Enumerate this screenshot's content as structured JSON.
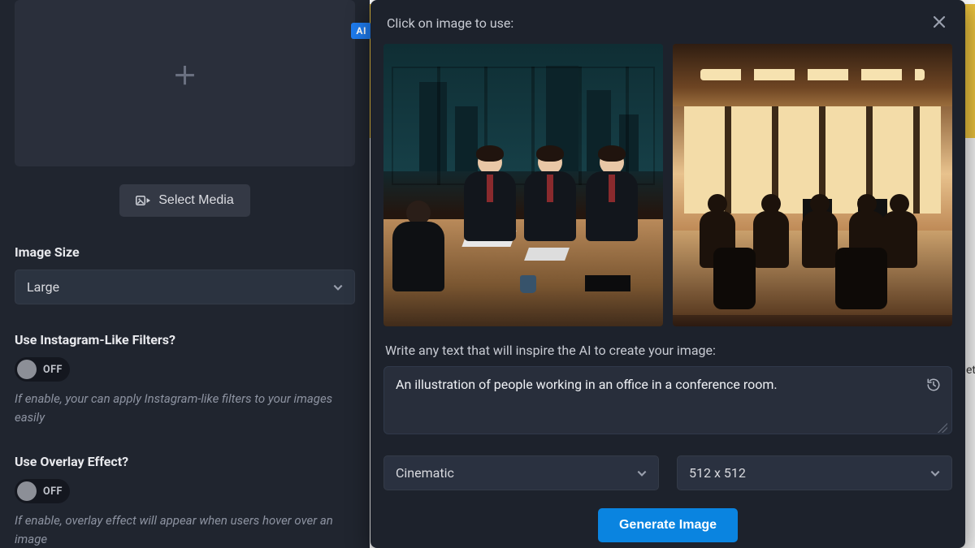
{
  "left": {
    "ai_badge": "AI",
    "select_media_label": "Select Media",
    "image_size": {
      "label": "Image Size",
      "value": "Large"
    },
    "filters": {
      "label": "Use Instagram-Like Filters?",
      "state": "OFF",
      "help": "If enable, your can apply Instagram-like filters to your images easily"
    },
    "overlay": {
      "label": "Use Overlay Effect?",
      "state": "OFF",
      "help": "If enable, overlay effect will appear when users hover over an image"
    }
  },
  "modal": {
    "header": "Click on image to use:",
    "prompt_label": "Write any text that will inspire the AI to create your image:",
    "prompt_value": "An illustration of people working in an office in a conference room.",
    "style_value": "Cinematic",
    "size_value": "512 x 512",
    "generate_label": "Generate Image"
  },
  "partial_right_text": "et"
}
